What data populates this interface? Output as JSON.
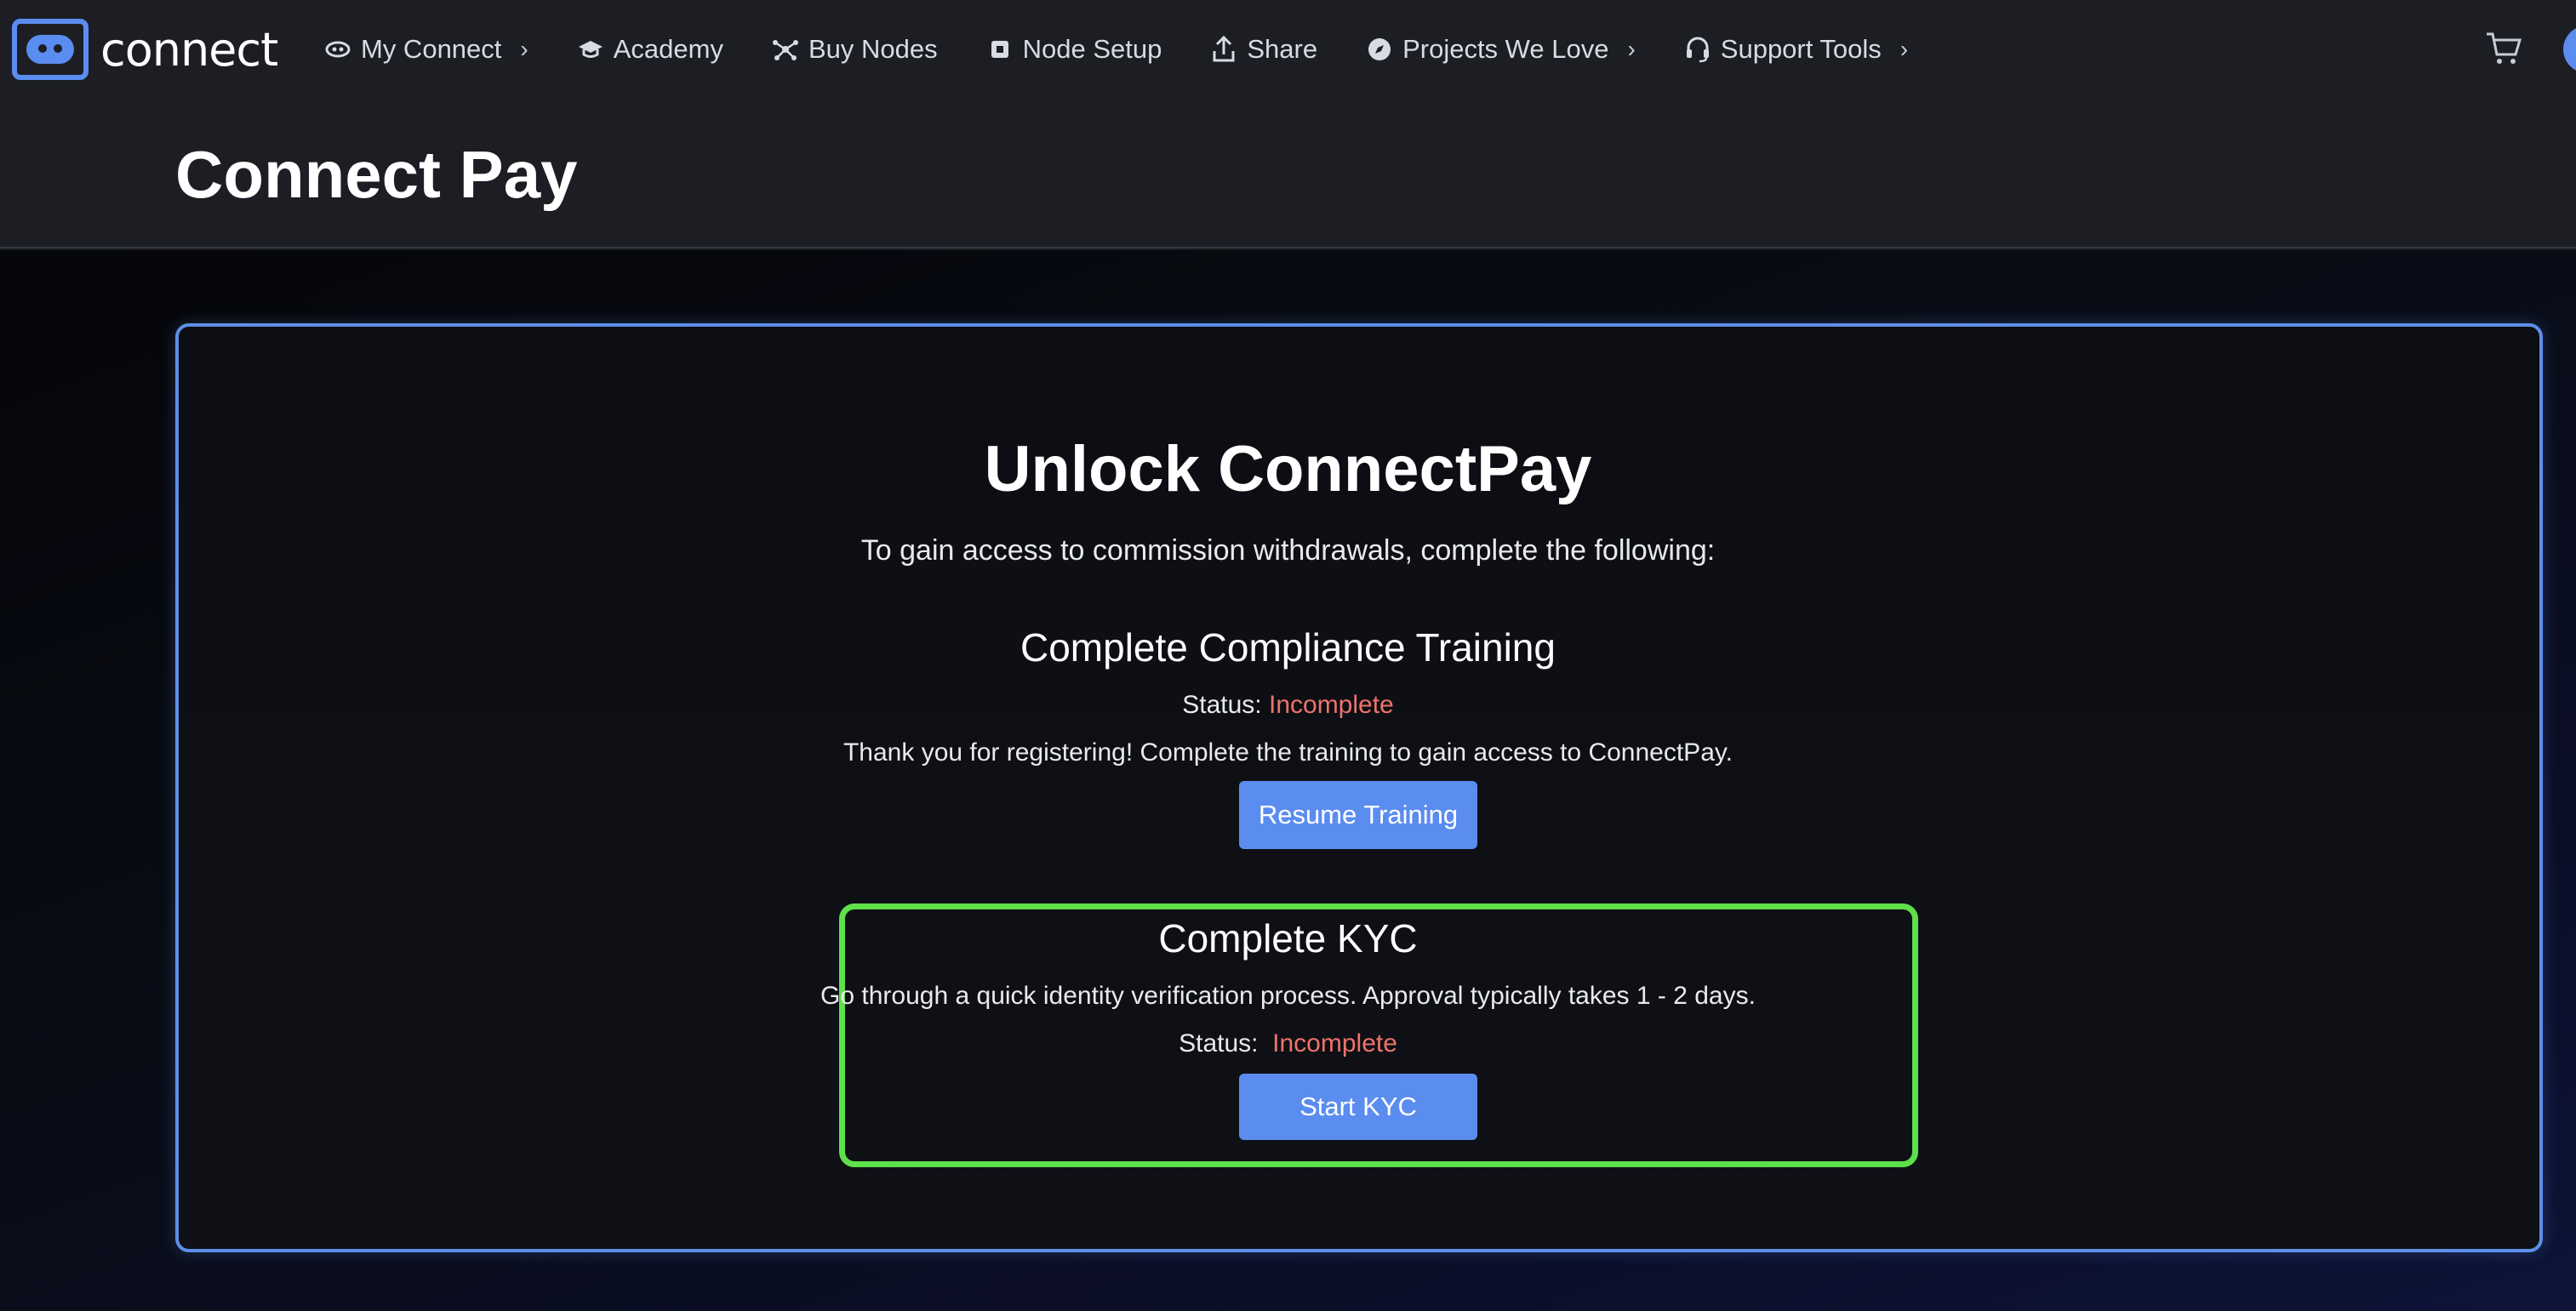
{
  "nav": {
    "logo_text": "connect",
    "items": [
      {
        "label": "My Connect",
        "icon": "eye-icon",
        "has_chevron": true
      },
      {
        "label": "Academy",
        "icon": "graduation-cap-icon",
        "has_chevron": false
      },
      {
        "label": "Buy Nodes",
        "icon": "nodes-icon",
        "has_chevron": false
      },
      {
        "label": "Node Setup",
        "icon": "setup-icon",
        "has_chevron": false
      },
      {
        "label": "Share",
        "icon": "share-icon",
        "has_chevron": false
      },
      {
        "label": "Projects We Love",
        "icon": "compass-icon",
        "has_chevron": true
      },
      {
        "label": "Support Tools",
        "icon": "headset-icon",
        "has_chevron": true
      }
    ],
    "cart_icon": "cart-icon"
  },
  "page": {
    "title": "Connect Pay"
  },
  "unlock": {
    "title": "Unlock ConnectPay",
    "subtitle": "To gain access to commission withdrawals, complete the following:"
  },
  "training": {
    "title": "Complete Compliance Training",
    "status_label": "Status:",
    "status_value": "Incomplete",
    "description": "Thank you for registering! Complete the training to gain access to ConnectPay.",
    "button_label": "Resume Training"
  },
  "kyc": {
    "title": "Complete KYC",
    "description": "Go through a quick identity verification process. Approval typically takes 1 - 2 days.",
    "status_label": "Status:",
    "status_value": "Incomplete",
    "button_label": "Start KYC"
  },
  "colors": {
    "accent": "#5b8cf0",
    "incomplete": "#f0736a",
    "highlight": "#5ee04a"
  }
}
